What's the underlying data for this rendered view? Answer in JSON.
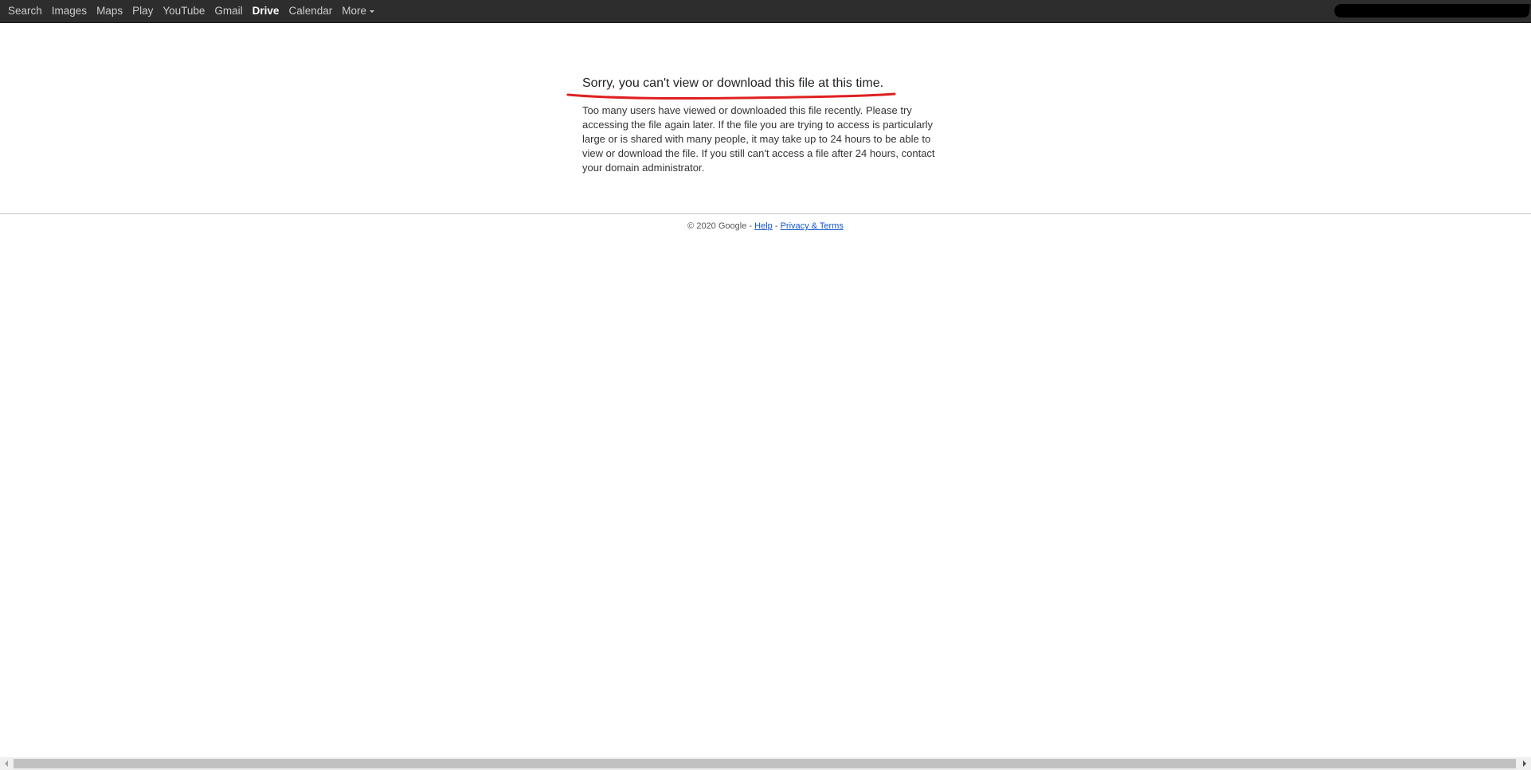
{
  "topbar": {
    "items": [
      {
        "label": "Search",
        "active": false
      },
      {
        "label": "Images",
        "active": false
      },
      {
        "label": "Maps",
        "active": false
      },
      {
        "label": "Play",
        "active": false
      },
      {
        "label": "YouTube",
        "active": false
      },
      {
        "label": "Gmail",
        "active": false
      },
      {
        "label": "Drive",
        "active": true
      },
      {
        "label": "Calendar",
        "active": false
      }
    ],
    "more_label": "More"
  },
  "error": {
    "title": "Sorry, you can't view or download this file at this time.",
    "body": "Too many users have viewed or downloaded this file recently. Please try accessing the file again later. If the file you are trying to access is particularly large or is shared with many people, it may take up to 24 hours to be able to view or download the file. If you still can't access a file after 24 hours, contact your domain administrator."
  },
  "footer": {
    "copyright": "© 2020 Google",
    "separator": "-",
    "help_label": "Help",
    "privacy_label": "Privacy & Terms"
  },
  "colors": {
    "topbar_bg": "#2d2d2d",
    "annotation_red": "#e02020",
    "link": "#1155cc"
  }
}
